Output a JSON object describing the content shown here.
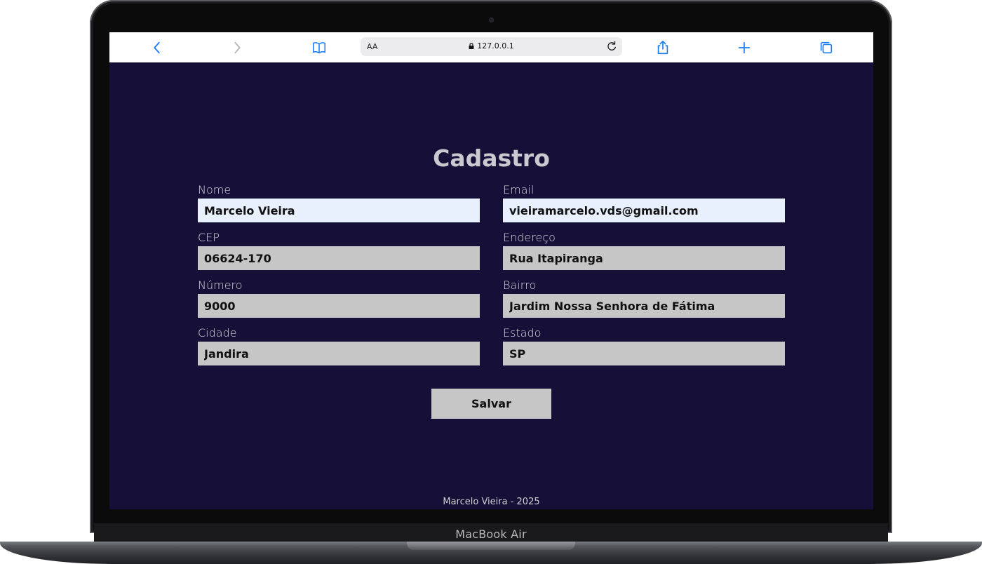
{
  "device": {
    "label": "MacBook Air"
  },
  "browser": {
    "text_size_label": "AA",
    "url": "127.0.0.1",
    "icons": [
      "chevron-left-icon",
      "chevron-right-icon",
      "book-icon",
      "lock-icon",
      "reload-icon",
      "share-icon",
      "plus-icon",
      "tabs-icon"
    ]
  },
  "page": {
    "title": "Cadastro",
    "fields": {
      "nome": {
        "label": "Nome",
        "value": "Marcelo Vieira"
      },
      "email": {
        "label": "Email",
        "value": "vieiramarcelo.vds@gmail.com"
      },
      "cep": {
        "label": "CEP",
        "value": "06624-170"
      },
      "endereco": {
        "label": "Endereço",
        "value": "Rua Itapiranga"
      },
      "numero": {
        "label": "Número",
        "value": "9000"
      },
      "bairro": {
        "label": "Bairro",
        "value": "Jardim Nossa Senhora de Fátima"
      },
      "cidade": {
        "label": "Cidade",
        "value": "Jandira"
      },
      "estado": {
        "label": "Estado",
        "value": "SP"
      }
    },
    "save_label": "Salvar",
    "footer": "Marcelo Vieira - 2025"
  },
  "colors": {
    "page_background": "#161038",
    "input_background": "#c6c6c6",
    "autofill_background": "#e8f0fe",
    "toolbar_accent": "#1a7cf4"
  }
}
